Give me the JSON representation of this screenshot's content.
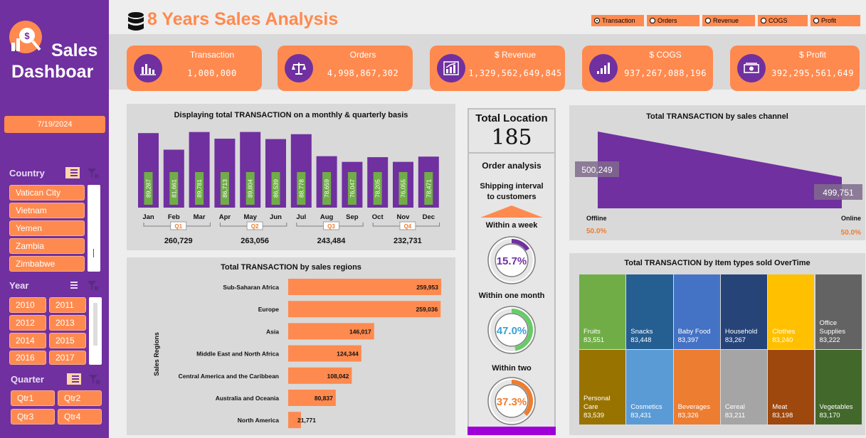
{
  "sidebar": {
    "title_line1": "Sales",
    "title_line2": "Dashboar",
    "date": "7/19/2024",
    "country_label": "Country",
    "countries": [
      "Vatican City",
      "Vietnam",
      "Yemen",
      "Zambia",
      "Zimbabwe"
    ],
    "year_label": "Year",
    "years": [
      "2010",
      "2011",
      "2012",
      "2013",
      "2014",
      "2015",
      "2016",
      "2017"
    ],
    "quarter_label": "Quarter",
    "quarters": [
      "Qtr1",
      "Qtr2",
      "Qtr3",
      "Qtr4"
    ]
  },
  "header": {
    "title": "8 Years Sales Analysis",
    "options": [
      "Transaction",
      "Orders",
      "Revenue",
      "COGS",
      "Profit"
    ],
    "selected_option": "Transaction"
  },
  "kpis": [
    {
      "label": "Transaction",
      "value": "1,000,000",
      "icon": "bar-chart-icon"
    },
    {
      "label": "Orders",
      "value": "4,998,867,302",
      "icon": "scale-icon"
    },
    {
      "label": "$ Revenue",
      "value": "1,329,562,649,845",
      "icon": "growth-chart-icon"
    },
    {
      "label": "$ COGS",
      "value": "937,267,088,196",
      "icon": "signal-bars-icon"
    },
    {
      "label": "$ Profit",
      "value": "392,295,561,649",
      "icon": "money-icon"
    }
  ],
  "location": {
    "label": "Total Location",
    "value": "185",
    "order_title": "Order analysis",
    "shipping_title": "Shipping interval to customers",
    "donuts": [
      {
        "label": "Within a week",
        "value": "15.7%",
        "pct": 15.7,
        "color": "#7030a0"
      },
      {
        "label": "Within one month",
        "value": "47.0%",
        "pct": 47.0,
        "color": "#66cc66",
        "text_color": "#3aa0d8"
      },
      {
        "label": "Within two",
        "value": "37.3%",
        "pct": 37.3,
        "color": "#ed7d31"
      }
    ]
  },
  "chart_data": [
    {
      "type": "bar",
      "title": "Displaying total TRANSACTION on a monthly & quarterly basis",
      "categories": [
        "Jan",
        "Feb",
        "Mar",
        "Apr",
        "May",
        "Jun",
        "Jul",
        "Aug",
        "Sep",
        "Oct",
        "Nov",
        "Dec"
      ],
      "values": [
        89287,
        81661,
        89781,
        86713,
        89804,
        86539,
        88778,
        78659,
        76047,
        78205,
        76055,
        78471
      ],
      "labels": [
        "89,287",
        "81,661",
        "89,781",
        "86,713",
        "89,804",
        "86,539",
        "88,778",
        "78,659",
        "76,047",
        "78,205",
        "76,055",
        "78,471"
      ],
      "quarters": [
        {
          "name": "Q1",
          "total": "260,729"
        },
        {
          "name": "Q2",
          "total": "263,056"
        },
        {
          "name": "Q3",
          "total": "243,484"
        },
        {
          "name": "Q4",
          "total": "232,731"
        }
      ],
      "bar_color": "#7030a0",
      "label_bg": "#70ad47"
    },
    {
      "type": "area",
      "title": "Total TRANSACTION by sales channel",
      "categories": [
        "Offline",
        "Online"
      ],
      "values": [
        500249,
        499751
      ],
      "labels": [
        "500,249",
        "499,751"
      ],
      "percents": [
        "50.0%",
        "50.0%"
      ],
      "color": "#7030a0"
    },
    {
      "type": "bar",
      "orientation": "horizontal",
      "title": "Total TRANSACTION by sales regions",
      "ylabel": "Sales Regions",
      "categories": [
        "Sub-Saharan Africa",
        "Europe",
        "Asia",
        "Middle East and North Africa",
        "Central America and the Caribbean",
        "Australia and Oceania",
        "North America"
      ],
      "values": [
        259953,
        259036,
        146017,
        124344,
        108042,
        80837,
        21771
      ],
      "labels": [
        "259,953",
        "259,036",
        "146,017",
        "124,344",
        "108,042",
        "80,837",
        "21,771"
      ],
      "color": "#ff8a4f"
    },
    {
      "type": "treemap",
      "title": "Total TRANSACTION by Item types sold OverTime",
      "items": [
        {
          "name": "Fruits",
          "value": "83,551",
          "color": "#70ad47"
        },
        {
          "name": "Snacks",
          "value": "83,448",
          "color": "#255e91"
        },
        {
          "name": "Baby Food",
          "value": "83,397",
          "color": "#4472c4"
        },
        {
          "name": "Household",
          "value": "83,267",
          "color": "#264478"
        },
        {
          "name": "Clothes",
          "value": "83,240",
          "color": "#ffc000"
        },
        {
          "name": "Office Supplies",
          "value": "83,222",
          "color": "#636363"
        },
        {
          "name": "Personal Care",
          "value": "83,539",
          "color": "#997300"
        },
        {
          "name": "Cosmetics",
          "value": "83,431",
          "color": "#5b9bd5"
        },
        {
          "name": "Beverages",
          "value": "83,326",
          "color": "#ed7d31"
        },
        {
          "name": "Cereal",
          "value": "83,211",
          "color": "#a5a5a5"
        },
        {
          "name": "Meat",
          "value": "83,198",
          "color": "#9e480e"
        },
        {
          "name": "Vegetables",
          "value": "83,170",
          "color": "#43682b"
        }
      ]
    }
  ]
}
